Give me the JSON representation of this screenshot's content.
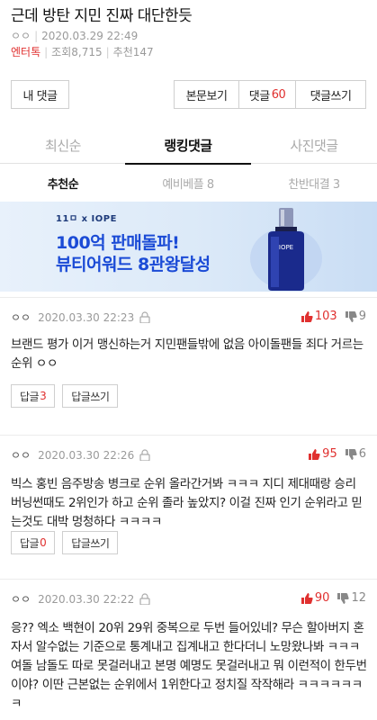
{
  "post": {
    "title": "근데 방탄 지민 진짜 대단한듯",
    "author": "ㅇㅇ",
    "datetime": "2020.03.29 22:49",
    "category": "엔터톡",
    "views": "조회8,715",
    "recommends": "추천147"
  },
  "buttons": {
    "my_comments": "내 댓글",
    "view_post": "본문보기",
    "comments_label": "댓글",
    "comments_count": "60",
    "write_comment": "댓글쓰기"
  },
  "tabs": [
    "최신순",
    "랭킹댓글",
    "사진댓글"
  ],
  "subtabs": [
    "추천순",
    "예비베플 8",
    "찬반대결 3"
  ],
  "banner": {
    "brand": "11ㅁ x IOPE",
    "line1": "100억 판매돌파!",
    "line2": "뷰티어워드 8관왕달성",
    "bottle_label": "IOPE",
    "colors": {
      "headline": "#1b4bd6",
      "bottle": "#1a2a8c"
    }
  },
  "comments": [
    {
      "author": "ㅇㅇ",
      "date": "2020.03.30 22:23",
      "up": "103",
      "down": "9",
      "text": "브랜드 평가 이거 맹신하는거 지민팬들밖에 없음 아이돌팬들 죄다 거르는 순위 ㅇㅇ",
      "reply_label": "답글",
      "reply_count": "3",
      "write_reply": "답글쓰기"
    },
    {
      "author": "ㅇㅇ",
      "date": "2020.03.30 22:26",
      "up": "95",
      "down": "6",
      "text": "빅스 홍빈 음주방송 병크로 순위 올라간거봐 ㅋㅋㅋ 지디 제대때랑 승리 버닝썬때도 2위인가 하고 순위 졸라 높았지? 이걸 진짜 인기 순위라고 믿는것도 대박 멍청하다 ㅋㅋㅋㅋ",
      "reply_label": "답글",
      "reply_count": "0",
      "write_reply": "답글쓰기"
    },
    {
      "author": "ㅇㅇ",
      "date": "2020.03.30 22:22",
      "up": "90",
      "down": "12",
      "text": "응?? 엑소 백현이 20위 29위 중복으로 두번 들어있네? 무슨 할아버지 혼자서 알수없는 기준으로 통계내고 집계내고 한다더니 노망왔나봐 ㅋㅋㅋ 여돌 남돌도 따로 못걸러내고 본명 예명도 못걸러내고 뭐 이런적이 한두번이야? 이딴 근본없는 순위에서 1위한다고 정치질 작작해라 ㅋㅋㅋㅋㅋㅋㅋ"
    }
  ],
  "colors": {
    "accent": "#e0302f",
    "muted": "#9a9a9a"
  }
}
